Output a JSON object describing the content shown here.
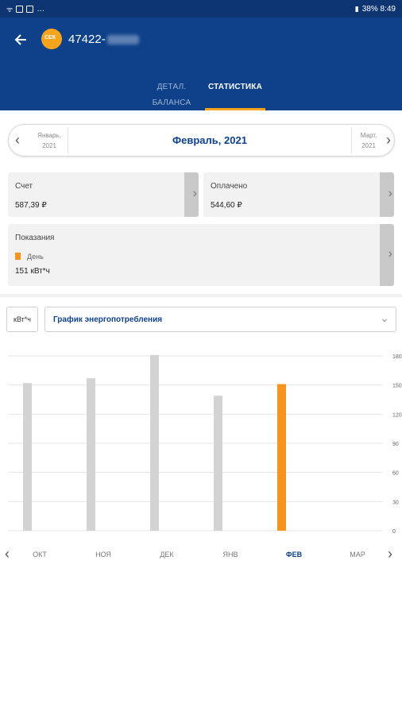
{
  "status_bar": {
    "left_icons": [
      "wifi-icon",
      "image-icon",
      "mail-icon",
      "more-icon"
    ],
    "right_text": "38% 8:49"
  },
  "header": {
    "account_number": "47422-",
    "logo_text": "СЕК",
    "tabs": [
      {
        "label": "ДЕТАЛ. БАЛАНСА",
        "active": false
      },
      {
        "label": "СТАТИСТИКА",
        "active": true
      }
    ]
  },
  "month_selector": {
    "prev": {
      "month": "Январь,",
      "year": "2021"
    },
    "current": "Февраль, 2021",
    "next": {
      "month": "Март,",
      "year": "2021"
    }
  },
  "cards": {
    "schet": {
      "label": "Счет",
      "value": "587,39 ₽"
    },
    "oplacheno": {
      "label": "Оплачено",
      "value": "544,60 ₽"
    },
    "pokazaniya": {
      "label": "Показания",
      "legend": "День",
      "value": "151 кВт*ч"
    }
  },
  "controls": {
    "unit": "кВт*ч",
    "graph_select": "График энергопотребления"
  },
  "colors": {
    "header_bg": "#0e4189",
    "accent": "#f7941d",
    "bar_inactive": "#d3d3d3"
  },
  "chart_data": {
    "type": "bar",
    "categories": [
      "ОКТ",
      "НОЯ",
      "ДЕК",
      "ЯНВ",
      "ФЕВ",
      "МАР"
    ],
    "values": [
      152,
      157,
      181,
      139,
      151,
      null
    ],
    "highlight_index": 4,
    "ylim": [
      0,
      180
    ],
    "yticks": [
      0,
      30,
      60,
      90,
      120,
      150,
      180
    ],
    "grid": true
  }
}
